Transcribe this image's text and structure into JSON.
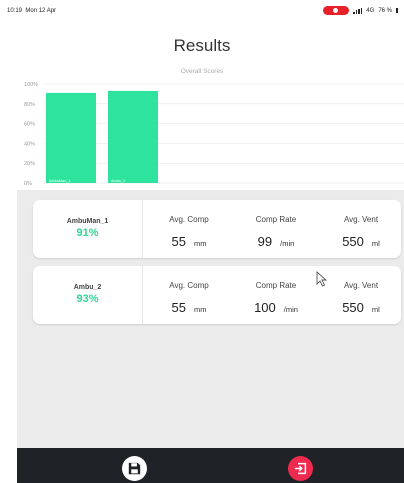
{
  "status": {
    "time": "10:19",
    "date": "Mon 12 Apr",
    "network": "4G",
    "battery": "76 %",
    "record_color": "#e8202a"
  },
  "header": {
    "title": "Results"
  },
  "chart_data": {
    "type": "bar",
    "title": "Overall Scores",
    "categories": [
      "AmbuMan_1",
      "Ambu_2"
    ],
    "values": [
      91,
      93
    ],
    "ylim": [
      0,
      100
    ],
    "yticks": [
      "0%",
      "20%",
      "40%",
      "60%",
      "80%",
      "100%"
    ],
    "ytick_values": [
      0,
      20,
      40,
      60,
      80,
      100
    ],
    "grid": true,
    "bar_color": "#2ee39e"
  },
  "results": [
    {
      "name": "AmbuMan_1",
      "score": "91%",
      "metrics": [
        {
          "label": "Avg. Comp",
          "value": "55",
          "unit": "mm"
        },
        {
          "label": "Comp Rate",
          "value": "99",
          "unit": "/min"
        },
        {
          "label": "Avg. Vent",
          "value": "550",
          "unit": "ml"
        }
      ]
    },
    {
      "name": "Ambu_2",
      "score": "93%",
      "metrics": [
        {
          "label": "Avg. Comp",
          "value": "55",
          "unit": "mm"
        },
        {
          "label": "Comp Rate",
          "value": "100",
          "unit": "/min"
        },
        {
          "label": "Avg. Vent",
          "value": "550",
          "unit": "ml"
        }
      ]
    }
  ],
  "toolbar": {
    "save_icon": "floppy-disk-icon",
    "exit_icon": "exit-icon",
    "exit_color": "#ee2a4f"
  },
  "colors": {
    "accent": "#2ed698",
    "bottom_bar": "#1f2227",
    "panel": "#ebebeb"
  }
}
